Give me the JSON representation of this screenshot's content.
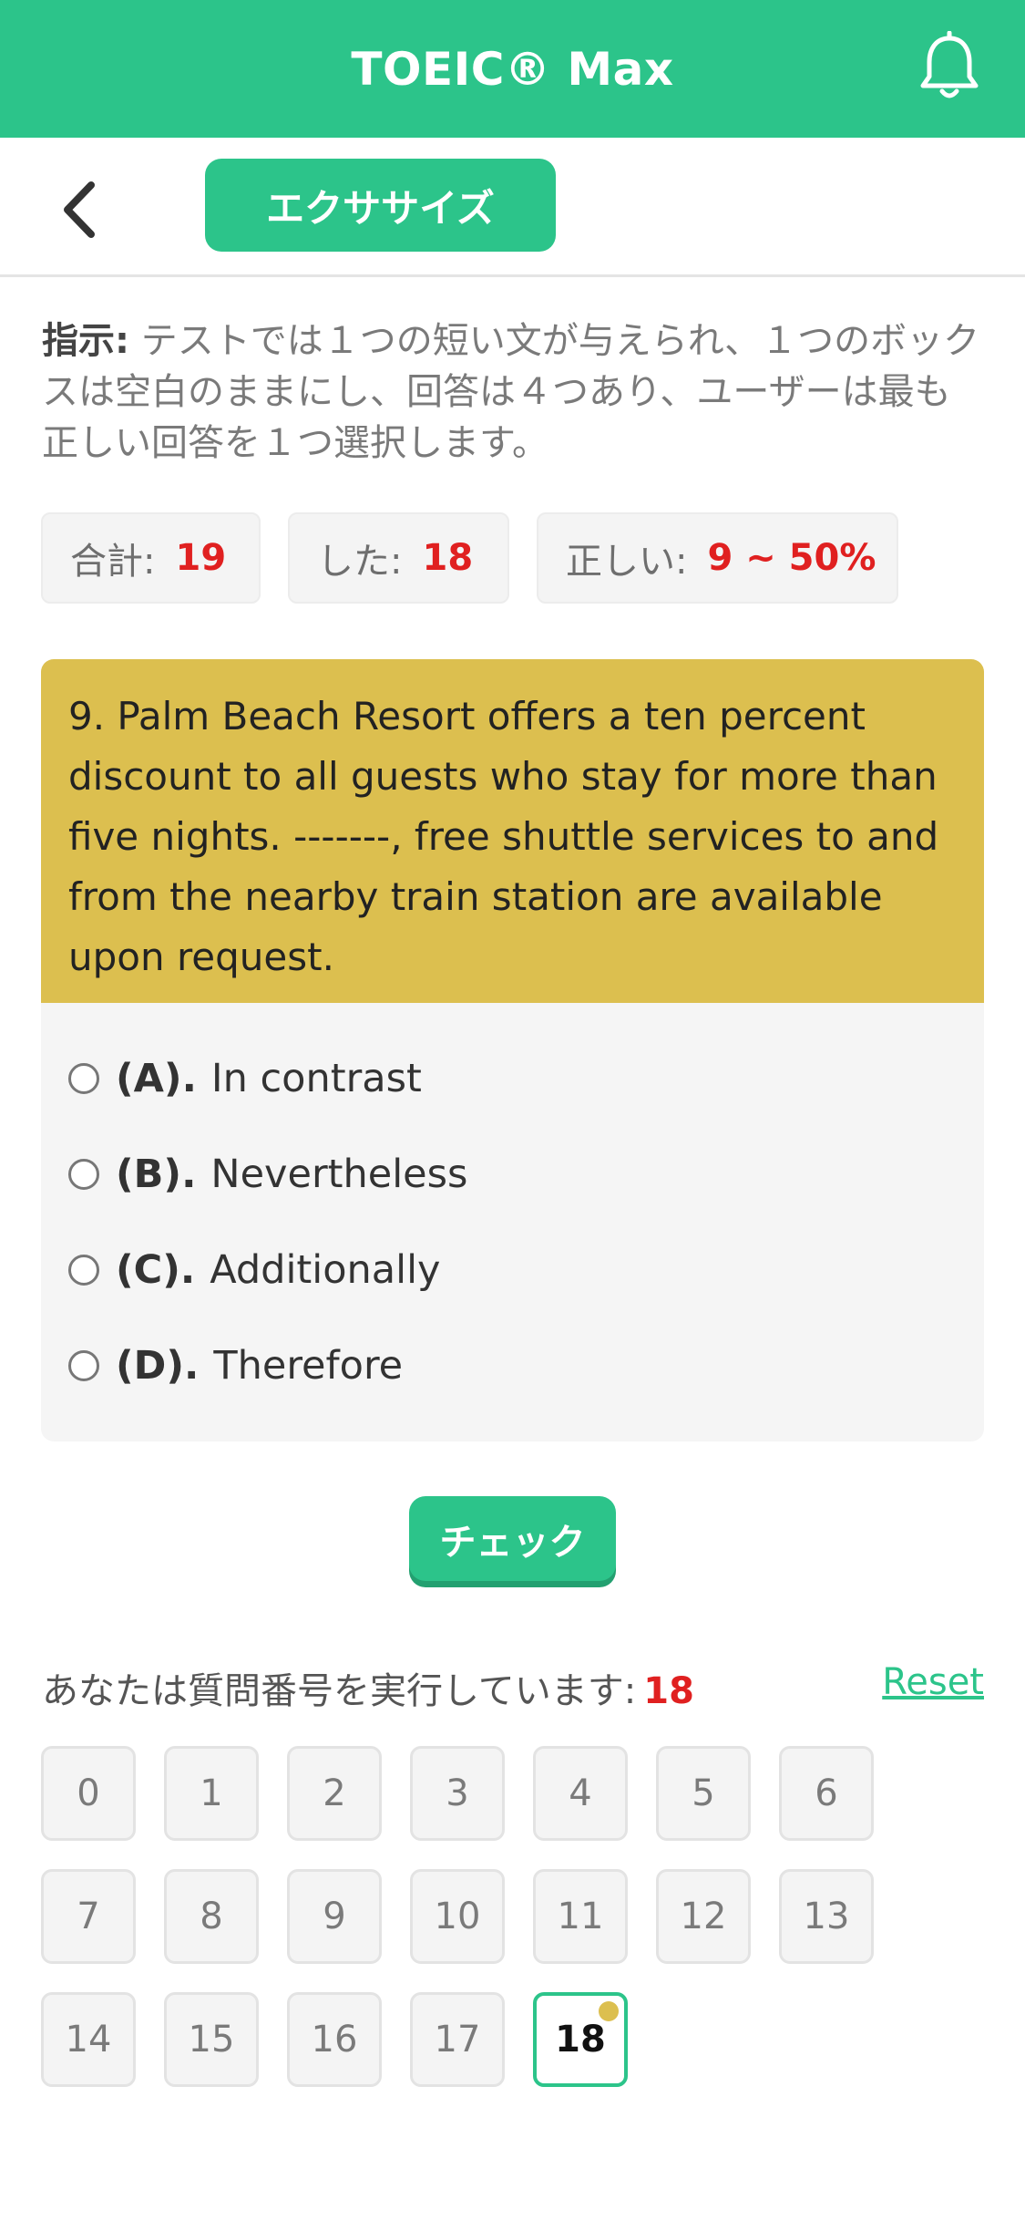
{
  "header": {
    "title": "TOEIC® Max"
  },
  "subbar": {
    "exercise_label": "エクササイズ"
  },
  "instructions": {
    "label": "指示:",
    "text": " テストでは１つの短い文が与えられ、１つのボックスは空白のままにし、回答は４つあり、ユーザーは最も正しい回答を１つ選択します。"
  },
  "stats": {
    "total_label": "合計:",
    "total_value": "19",
    "done_label": "した:",
    "done_value": "18",
    "correct_label": "正しい:",
    "correct_value": "9 ~ 50%"
  },
  "question": {
    "text": "9. Palm Beach Resort offers a ten percent discount to all guests who stay for more than five nights. -------, free shuttle services to and from the nearby train station are available upon request."
  },
  "options": [
    {
      "letter": "(A).",
      "text": "In contrast"
    },
    {
      "letter": "(B).",
      "text": "Nevertheless"
    },
    {
      "letter": "(C).",
      "text": "Additionally"
    },
    {
      "letter": "(D).",
      "text": "Therefore"
    }
  ],
  "check_label": "チェック",
  "progress": {
    "label": "あなたは質問番号を実行しています:",
    "current": "18",
    "reset_label": "Reset"
  },
  "numbers": [
    "0",
    "1",
    "2",
    "3",
    "4",
    "5",
    "6",
    "7",
    "8",
    "9",
    "10",
    "11",
    "12",
    "13",
    "14",
    "15",
    "16",
    "17",
    "18"
  ],
  "colors": {
    "accent": "#2cc48a",
    "question_bg": "#dcbf4f",
    "highlight": "#e02020"
  },
  "icons": {
    "header_right": "bell-icon",
    "back": "chevron-left-icon"
  }
}
